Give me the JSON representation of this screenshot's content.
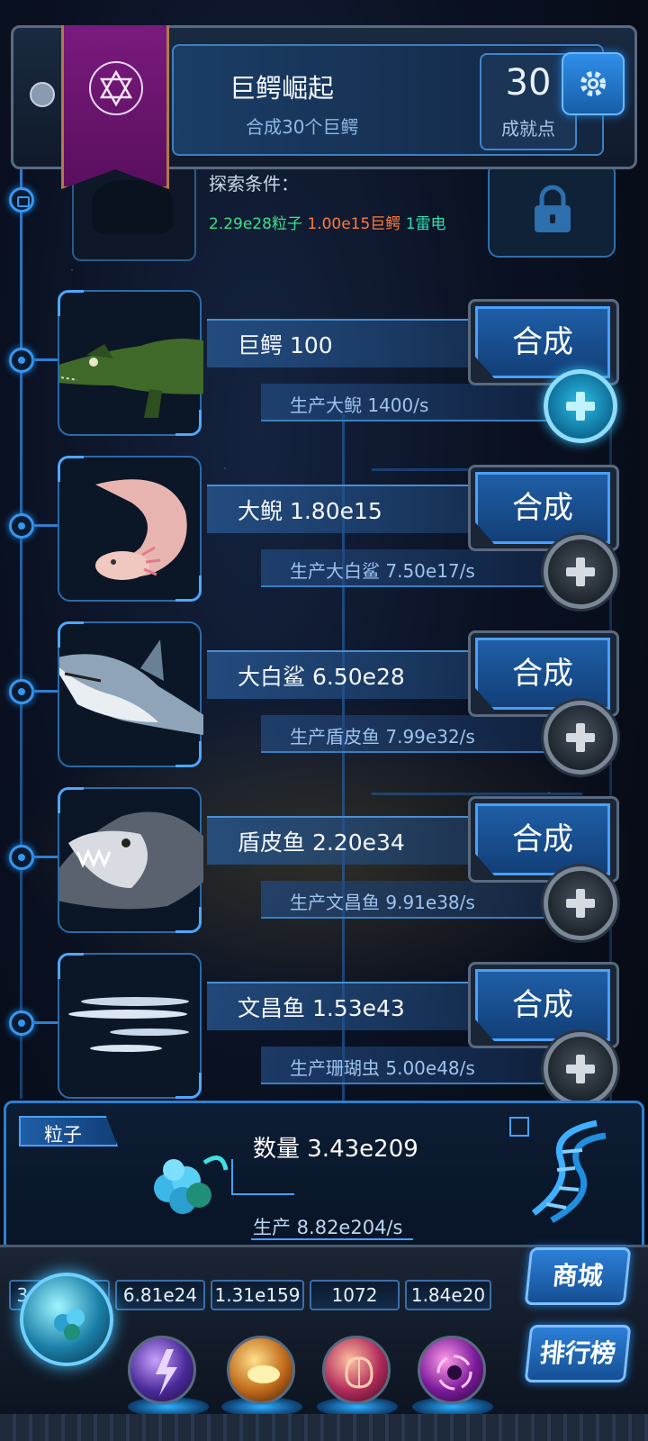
{
  "achievement": {
    "title": "巨鳄崛起",
    "description": "合成30个巨鳄",
    "points": "30",
    "points_label": "成就点",
    "partial_label": "粒"
  },
  "locked": {
    "explore_label": "探索条件：",
    "cond_particles": "2.29e28粒子",
    "cond_crocs": "1.00e15巨鳄",
    "cond_thunder": "1雷电"
  },
  "creatures": [
    {
      "name_label": "巨鳄 100",
      "production": "生产大鲵 1400/s",
      "merge_label": "合成",
      "icon": "crocodile-icon",
      "plus_active": true
    },
    {
      "name_label": "大鲵 1.80e15",
      "production": "生产大白鲨 7.50e17/s",
      "merge_label": "合成",
      "icon": "salamander-icon",
      "plus_active": false
    },
    {
      "name_label": "大白鲨 6.50e28",
      "production": "生产盾皮鱼 7.99e32/s",
      "merge_label": "合成",
      "icon": "shark-icon",
      "plus_active": false
    },
    {
      "name_label": "盾皮鱼 2.20e34",
      "production": "生产文昌鱼 9.91e38/s",
      "merge_label": "合成",
      "icon": "dunkleosteus-icon",
      "plus_active": false
    },
    {
      "name_label": "文昌鱼 1.53e43",
      "production": "生产珊瑚虫 5.00e48/s",
      "merge_label": "合成",
      "icon": "lancelet-icon",
      "plus_active": false
    }
  ],
  "particle": {
    "tag": "粒子",
    "count": "数量 3.43e209",
    "rate": "生产 8.82e204/s"
  },
  "resources": [
    {
      "value": "3.43e209",
      "icon": "particle-orb-icon"
    },
    {
      "value": "6.81e24",
      "icon": "thunder-orb-icon"
    },
    {
      "value": "1.31e159",
      "icon": "fire-orb-icon"
    },
    {
      "value": "1072",
      "icon": "brain-orb-icon"
    },
    {
      "value": "1.84e20",
      "icon": "vortex-orb-icon"
    }
  ],
  "side_buttons": {
    "shop": "商城",
    "ranking": "排行榜"
  },
  "colors": {
    "accent": "#2f8fe8",
    "cond_green": "#3ee08a",
    "cond_orange": "#ff7a3a",
    "cond_teal": "#30e0b0"
  }
}
